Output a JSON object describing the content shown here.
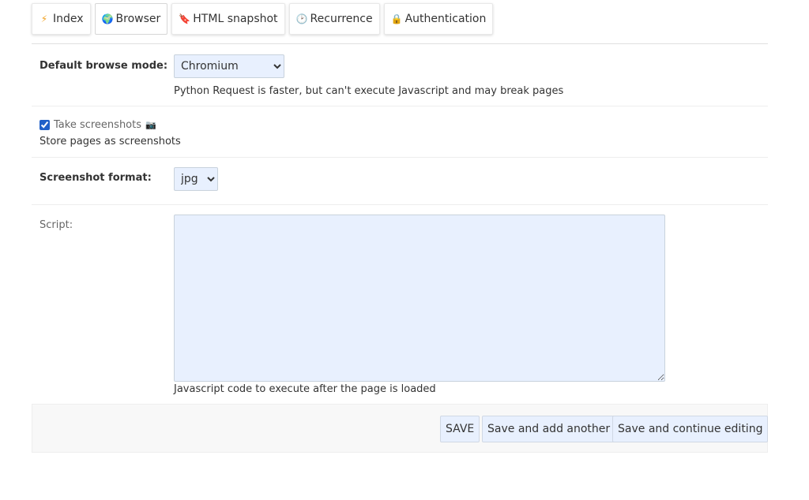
{
  "tabs": [
    {
      "label": "Index",
      "icon": "lightning-icon",
      "glyph": "⚡",
      "color": "#f0a020"
    },
    {
      "label": "Browser",
      "icon": "globe-icon",
      "glyph": "🌍",
      "color": "#3a8a3a"
    },
    {
      "label": "HTML snapshot",
      "icon": "bookmark-icon",
      "glyph": "🔖",
      "color": "#c03030"
    },
    {
      "label": "Recurrence",
      "icon": "clock-icon",
      "glyph": "🕑",
      "color": "#888888"
    },
    {
      "label": "Authentication",
      "icon": "lock-icon",
      "glyph": "🔒",
      "color": "#e0a020"
    }
  ],
  "active_tab": "Browser",
  "browse_mode": {
    "label": "Default browse mode:",
    "selected": "Chromium",
    "help": "Python Request is faster, but can't execute Javascript and may break pages"
  },
  "screenshots": {
    "checkbox_label": "Take screenshots",
    "icon": "camera-icon",
    "checked": true,
    "help": "Store pages as screenshots"
  },
  "screenshot_format": {
    "label": "Screenshot format:",
    "selected": "jpg"
  },
  "script": {
    "label": "Script:",
    "value": "",
    "help": "Javascript code to execute after the page is loaded"
  },
  "buttons": {
    "save": "SAVE",
    "save_add": "Save and add another",
    "save_continue": "Save and continue editing"
  }
}
